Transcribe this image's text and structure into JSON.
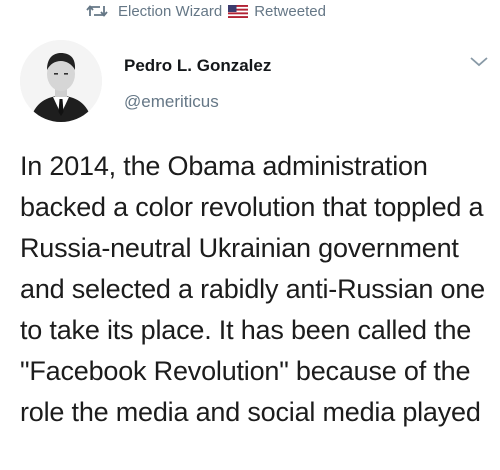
{
  "retweet": {
    "retweeter": "Election Wizard",
    "label": "Retweeted",
    "icon": "retweet-icon",
    "flag_icon": "us-flag-icon"
  },
  "author": {
    "display_name": "Pedro L. Gonzalez",
    "handle": "@emeriticus",
    "avatar_icon": "profile-photo"
  },
  "menu": {
    "icon": "chevron-down-icon"
  },
  "tweet": {
    "text": "In 2014, the Obama administration backed a color revolution that toppled a Russia-neutral Ukrainian government and selected a rabidly anti-Russian one to take its place. It has been called the \"Facebook Revolution\" because of the role the media and social media played"
  },
  "colors": {
    "secondary_text": "#657786",
    "primary_text": "#14171a"
  }
}
